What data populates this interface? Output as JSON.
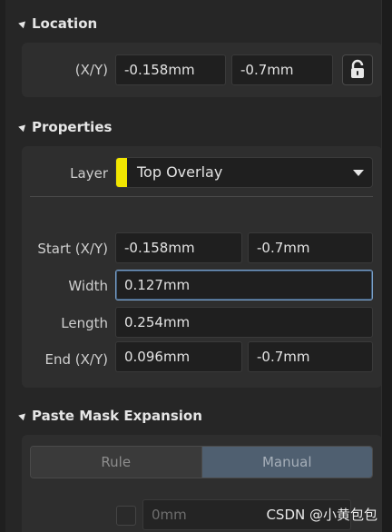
{
  "location": {
    "header": "Location",
    "xy_label": "(X/Y)",
    "x_value": "-0.158mm",
    "y_value": "-0.7mm",
    "lock_icon": "padlock-icon"
  },
  "properties": {
    "header": "Properties",
    "layer_label": "Layer",
    "layer_value": "Top Overlay",
    "layer_color": "#f2e600",
    "start_label": "Start (X/Y)",
    "start_x": "-0.158mm",
    "start_y": "-0.7mm",
    "width_label": "Width",
    "width_value": "0.127mm",
    "length_label": "Length",
    "length_value": "0.254mm",
    "end_label": "End (X/Y)",
    "end_x": "0.096mm",
    "end_y": "-0.7mm"
  },
  "paste_mask": {
    "header": "Paste Mask Expansion",
    "rule_label": "Rule",
    "manual_label": "Manual",
    "value_placeholder": "0mm"
  },
  "watermark": "CSDN @小黄包包"
}
